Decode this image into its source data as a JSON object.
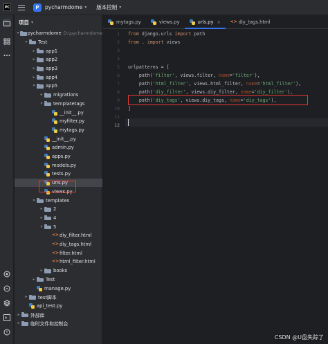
{
  "app": {
    "project_name": "pycharmdome",
    "project_badge": "P",
    "vcs_label": "版本控制",
    "logo_text": "PC"
  },
  "panel": {
    "title": "项目"
  },
  "tree": [
    {
      "label": "pycharmdome",
      "sub": "D:\\pycharmdome",
      "type": "folder",
      "depth": 0,
      "expanded": true
    },
    {
      "label": "Test",
      "type": "folder",
      "depth": 1,
      "expanded": true
    },
    {
      "label": "app1",
      "type": "folder",
      "depth": 2,
      "expanded": false
    },
    {
      "label": "app2",
      "type": "folder",
      "depth": 2,
      "expanded": false
    },
    {
      "label": "app3",
      "type": "folder",
      "depth": 2,
      "expanded": false
    },
    {
      "label": "app4",
      "type": "folder",
      "depth": 2,
      "expanded": false
    },
    {
      "label": "app5",
      "type": "folder",
      "depth": 2,
      "expanded": true
    },
    {
      "label": "migrations",
      "type": "folder",
      "depth": 3,
      "expanded": false
    },
    {
      "label": "templatetags",
      "type": "folder",
      "depth": 3,
      "expanded": true
    },
    {
      "label": "__init__.py",
      "type": "py",
      "depth": 4
    },
    {
      "label": "myfilter.py",
      "type": "py",
      "depth": 4
    },
    {
      "label": "mytags.py",
      "type": "py",
      "depth": 4
    },
    {
      "label": "__init__.py",
      "type": "py",
      "depth": 3
    },
    {
      "label": "admin.py",
      "type": "py",
      "depth": 3
    },
    {
      "label": "apps.py",
      "type": "py",
      "depth": 3
    },
    {
      "label": "models.py",
      "type": "py",
      "depth": 3
    },
    {
      "label": "tests.py",
      "type": "py",
      "depth": 3
    },
    {
      "label": "urls.py",
      "type": "py",
      "depth": 3,
      "selected": true
    },
    {
      "label": "views.py",
      "type": "py",
      "depth": 3
    },
    {
      "label": "templates",
      "type": "folder",
      "depth": 2,
      "expanded": true
    },
    {
      "label": "2",
      "type": "folder",
      "depth": 3,
      "expanded": false
    },
    {
      "label": "4",
      "type": "folder",
      "depth": 3,
      "expanded": false
    },
    {
      "label": "5",
      "type": "folder",
      "depth": 3,
      "expanded": true
    },
    {
      "label": "diy_filter.html",
      "type": "html",
      "depth": 4
    },
    {
      "label": "diy_tags.html",
      "type": "html",
      "depth": 4
    },
    {
      "label": "filter.html",
      "type": "html",
      "depth": 4
    },
    {
      "label": "html_filter.html",
      "type": "html",
      "depth": 4
    },
    {
      "label": "books",
      "type": "folder",
      "depth": 3,
      "expanded": false
    },
    {
      "label": "Test",
      "type": "folder",
      "depth": 2,
      "expanded": false
    },
    {
      "label": "manage.py",
      "type": "py",
      "depth": 2
    },
    {
      "label": "test脚本",
      "type": "folder",
      "depth": 1,
      "expanded": false
    },
    {
      "label": "api_test.py",
      "type": "py",
      "depth": 1
    },
    {
      "label": "外部库",
      "type": "lib",
      "depth": 0,
      "expanded": false
    },
    {
      "label": "临时文件和控制台",
      "type": "scratch",
      "depth": 0,
      "expanded": false
    }
  ],
  "tabs": [
    {
      "label": "mytags.py",
      "icon": "python-file-icon",
      "active": false
    },
    {
      "label": "views.py",
      "icon": "python-file-icon",
      "active": false
    },
    {
      "label": "urls.py",
      "icon": "python-file-icon",
      "active": true
    },
    {
      "label": "diy_tags.html",
      "icon": "html-file-icon",
      "active": false
    }
  ],
  "tab_close": "×",
  "editor": {
    "current_line": 12,
    "lines": [
      {
        "n": "1",
        "code": "from django.urls import path"
      },
      {
        "n": "2",
        "code": "from . import views"
      },
      {
        "n": "3",
        "code": ""
      },
      {
        "n": "4",
        "code": ""
      },
      {
        "n": "5",
        "code": "urlpatterns = ["
      },
      {
        "n": "6",
        "code": "    path('filter', views.filter, name='filter'),"
      },
      {
        "n": "7",
        "code": "    path('html_filter', views.html_filter, name='html_filter'),"
      },
      {
        "n": "8",
        "code": "    path('diy_filter', views.diy_filter, name='diy_filter'),"
      },
      {
        "n": "9",
        "code": "    path('diy_tags', views.diy_tags, name='diy_tags'),"
      },
      {
        "n": "10",
        "code": "]"
      },
      {
        "n": "11",
        "code": ""
      },
      {
        "n": "12",
        "code": ""
      }
    ]
  },
  "watermark": "CSDN @U盘失踪了"
}
